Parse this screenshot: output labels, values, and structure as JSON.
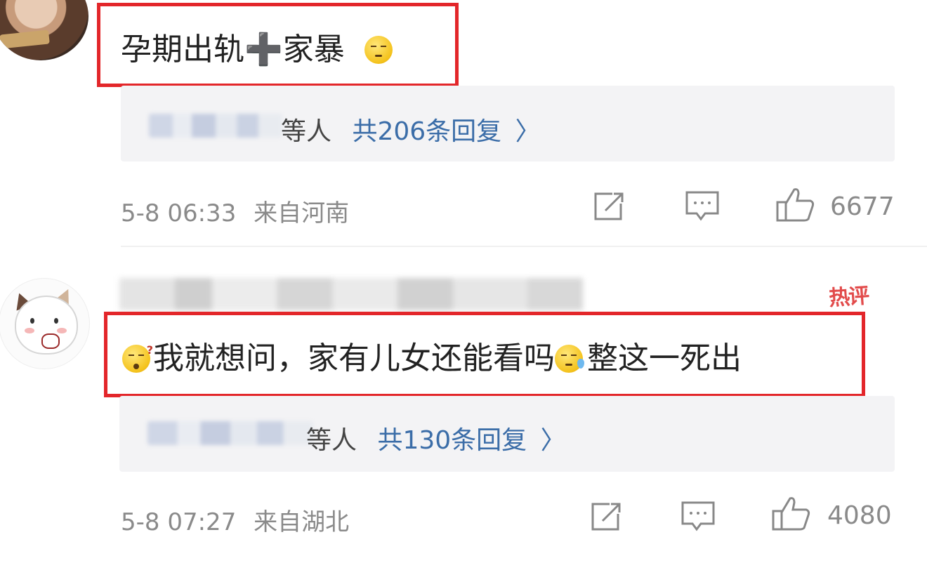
{
  "comments": [
    {
      "text": "孕期出轨",
      "plus": "➕",
      "text_after": "家暴",
      "reply_suffix": "等人",
      "reply_count": "共206条回复",
      "chevron": "〉",
      "time": "5-8 06:33",
      "location": "来自河南",
      "likes": "6677",
      "icons": [
        "share-icon",
        "comment-icon",
        "like-icon"
      ]
    },
    {
      "badge": "热评",
      "text": "我就想问，家有儿女还能看吗",
      "text_after": "整这一死出",
      "reply_suffix": "等人",
      "reply_count": "共130条回复",
      "chevron": "〉",
      "time": "5-8 07:27",
      "location": "来自湖北",
      "likes": "4080",
      "icons": [
        "share-icon",
        "comment-icon",
        "like-icon"
      ]
    }
  ],
  "colors": {
    "highlight_border": "#e3262a",
    "link_blue": "#3b6da8",
    "meta_gray": "#8a8a8a",
    "hot_badge": "#e24b4b"
  }
}
